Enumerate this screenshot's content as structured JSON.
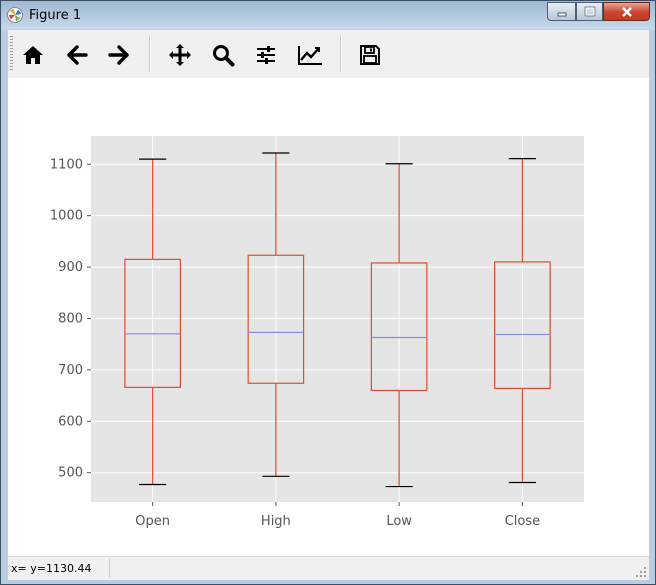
{
  "window": {
    "title": "Figure 1"
  },
  "toolbar": {
    "buttons": [
      {
        "icon": "home-icon"
      },
      {
        "icon": "back-arrow-icon"
      },
      {
        "icon": "forward-arrow-icon"
      },
      {
        "icon": "pan-icon"
      },
      {
        "icon": "zoom-icon"
      },
      {
        "icon": "configure-subplots-icon"
      },
      {
        "icon": "edit-axis-icon"
      },
      {
        "icon": "save-icon"
      }
    ]
  },
  "status": {
    "coords": "x= y=1130.44"
  },
  "colors": {
    "box": "#e24a33",
    "median": "#8b8bf0",
    "plot_bg": "#e5e5e5",
    "grid": "#ffffff"
  },
  "chart_data": {
    "type": "box",
    "title": "",
    "xlabel": "",
    "ylabel": "",
    "categories": [
      "Open",
      "High",
      "Low",
      "Close"
    ],
    "ylim": [
      443,
      1155
    ],
    "yticks": [
      500,
      600,
      700,
      800,
      900,
      1000,
      1100
    ],
    "grid": true,
    "boxes": [
      {
        "name": "Open",
        "whislo": 477,
        "q1": 666,
        "med": 770,
        "q3": 915,
        "whishi": 1110
      },
      {
        "name": "High",
        "whislo": 493,
        "q1": 674,
        "med": 773,
        "q3": 923,
        "whishi": 1122
      },
      {
        "name": "Low",
        "whislo": 473,
        "q1": 660,
        "med": 763,
        "q3": 908,
        "whishi": 1101
      },
      {
        "name": "Close",
        "whislo": 481,
        "q1": 664,
        "med": 769,
        "q3": 910,
        "whishi": 1111
      }
    ]
  }
}
